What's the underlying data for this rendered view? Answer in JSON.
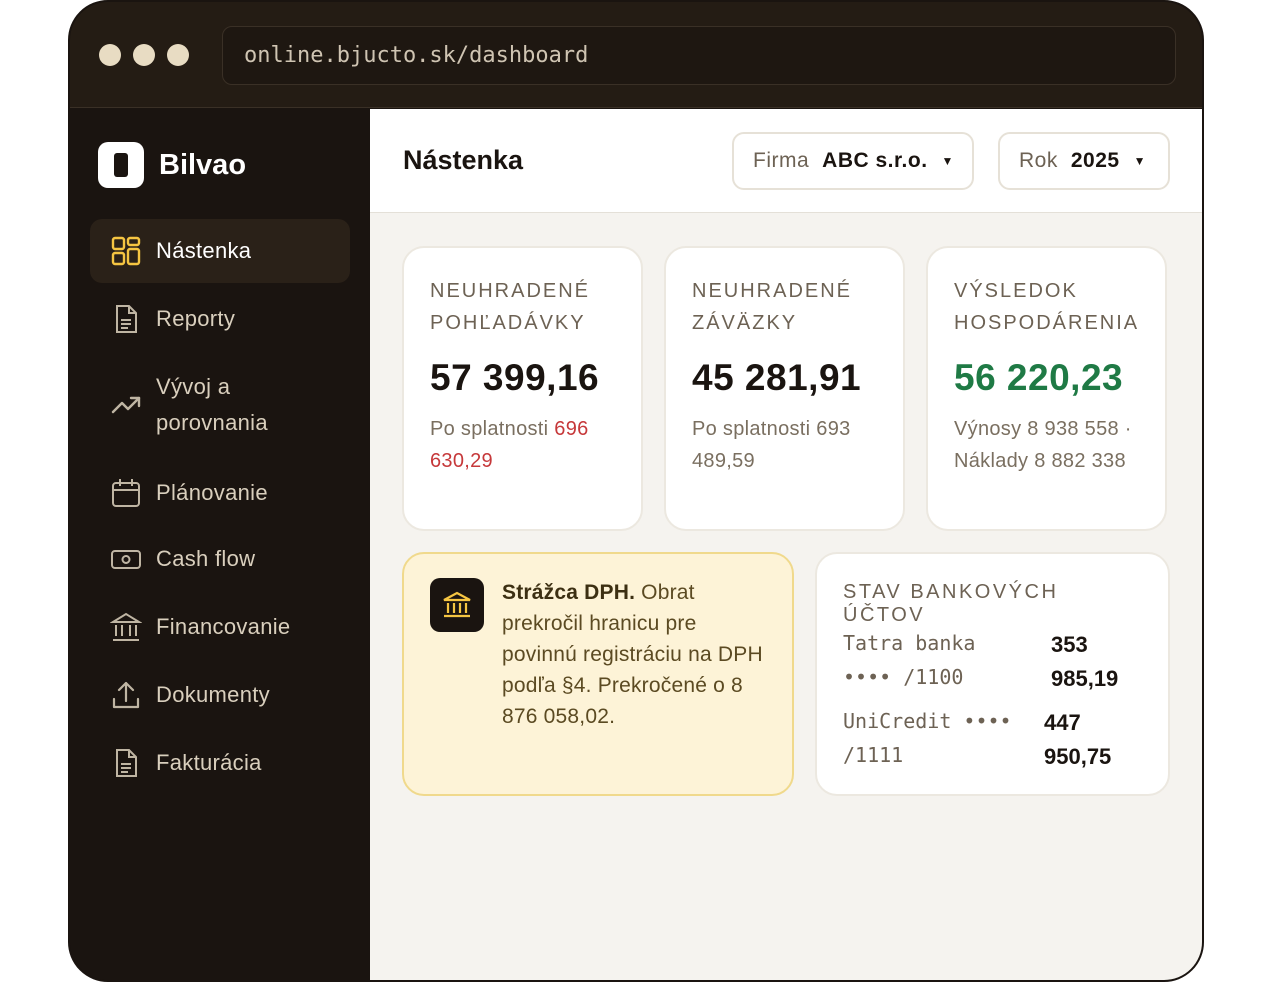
{
  "browser": {
    "url": "online.bjucto.sk/dashboard"
  },
  "sidebar": {
    "brand": "Bilvao",
    "items": [
      {
        "label": "Nástenka",
        "icon": "dashboard-grid-icon",
        "active": true
      },
      {
        "label": "Reporty",
        "icon": "document-icon"
      },
      {
        "label": "Vývoj a porovnania",
        "icon": "trend-up-icon"
      },
      {
        "label": "Plánovanie",
        "icon": "calendar-icon"
      },
      {
        "label": "Cash flow",
        "icon": "banknote-icon"
      },
      {
        "label": "Financovanie",
        "icon": "bank-icon"
      },
      {
        "label": "Dokumenty",
        "icon": "upload-icon"
      },
      {
        "label": "Fakturácia",
        "icon": "invoice-icon"
      }
    ]
  },
  "header": {
    "title": "Nástenka",
    "firma": {
      "label": "Firma",
      "value": "ABC s.r.o."
    },
    "rok": {
      "label": "Rok",
      "value": "2025"
    }
  },
  "kpis": [
    {
      "label": "NEUHRADENÉ POHĽADÁVKY",
      "value": "57 399,16",
      "sub_prefix": "Po splatnosti ",
      "sub_value": "696 630,29"
    },
    {
      "label": "NEUHRADENÉ ZÁVÄZKY",
      "value": "45 281,91",
      "sub_prefix": "Po splatnosti ",
      "sub_value": "693 489,59"
    },
    {
      "label": "VÝSLEDOK HOSPODÁRENIA",
      "value": "56 220,23",
      "sub": "Výnosy 8 938 558 · Náklady 8 882 338"
    }
  ],
  "alert": {
    "title": "Strážca DPH.",
    "text": " Obrat prekročil hranicu pre povinnú registráciu na DPH podľa §4. Prekročené o 8 876 058,02.",
    "icon": "bank-icon"
  },
  "bank_accounts": {
    "title": "STAV BANKOVÝCH ÚČTOV",
    "rows": [
      {
        "name": "Tatra banka •••• /1100",
        "amount": "353 985,19"
      },
      {
        "name": "UniCredit •••• /1111",
        "amount": "447 950,75"
      }
    ]
  },
  "colors": {
    "accent_yellow": "#f5c542",
    "positive_green": "#1f7a45",
    "negative_red": "#c6383a",
    "sidebar_bg": "#1a1410"
  }
}
